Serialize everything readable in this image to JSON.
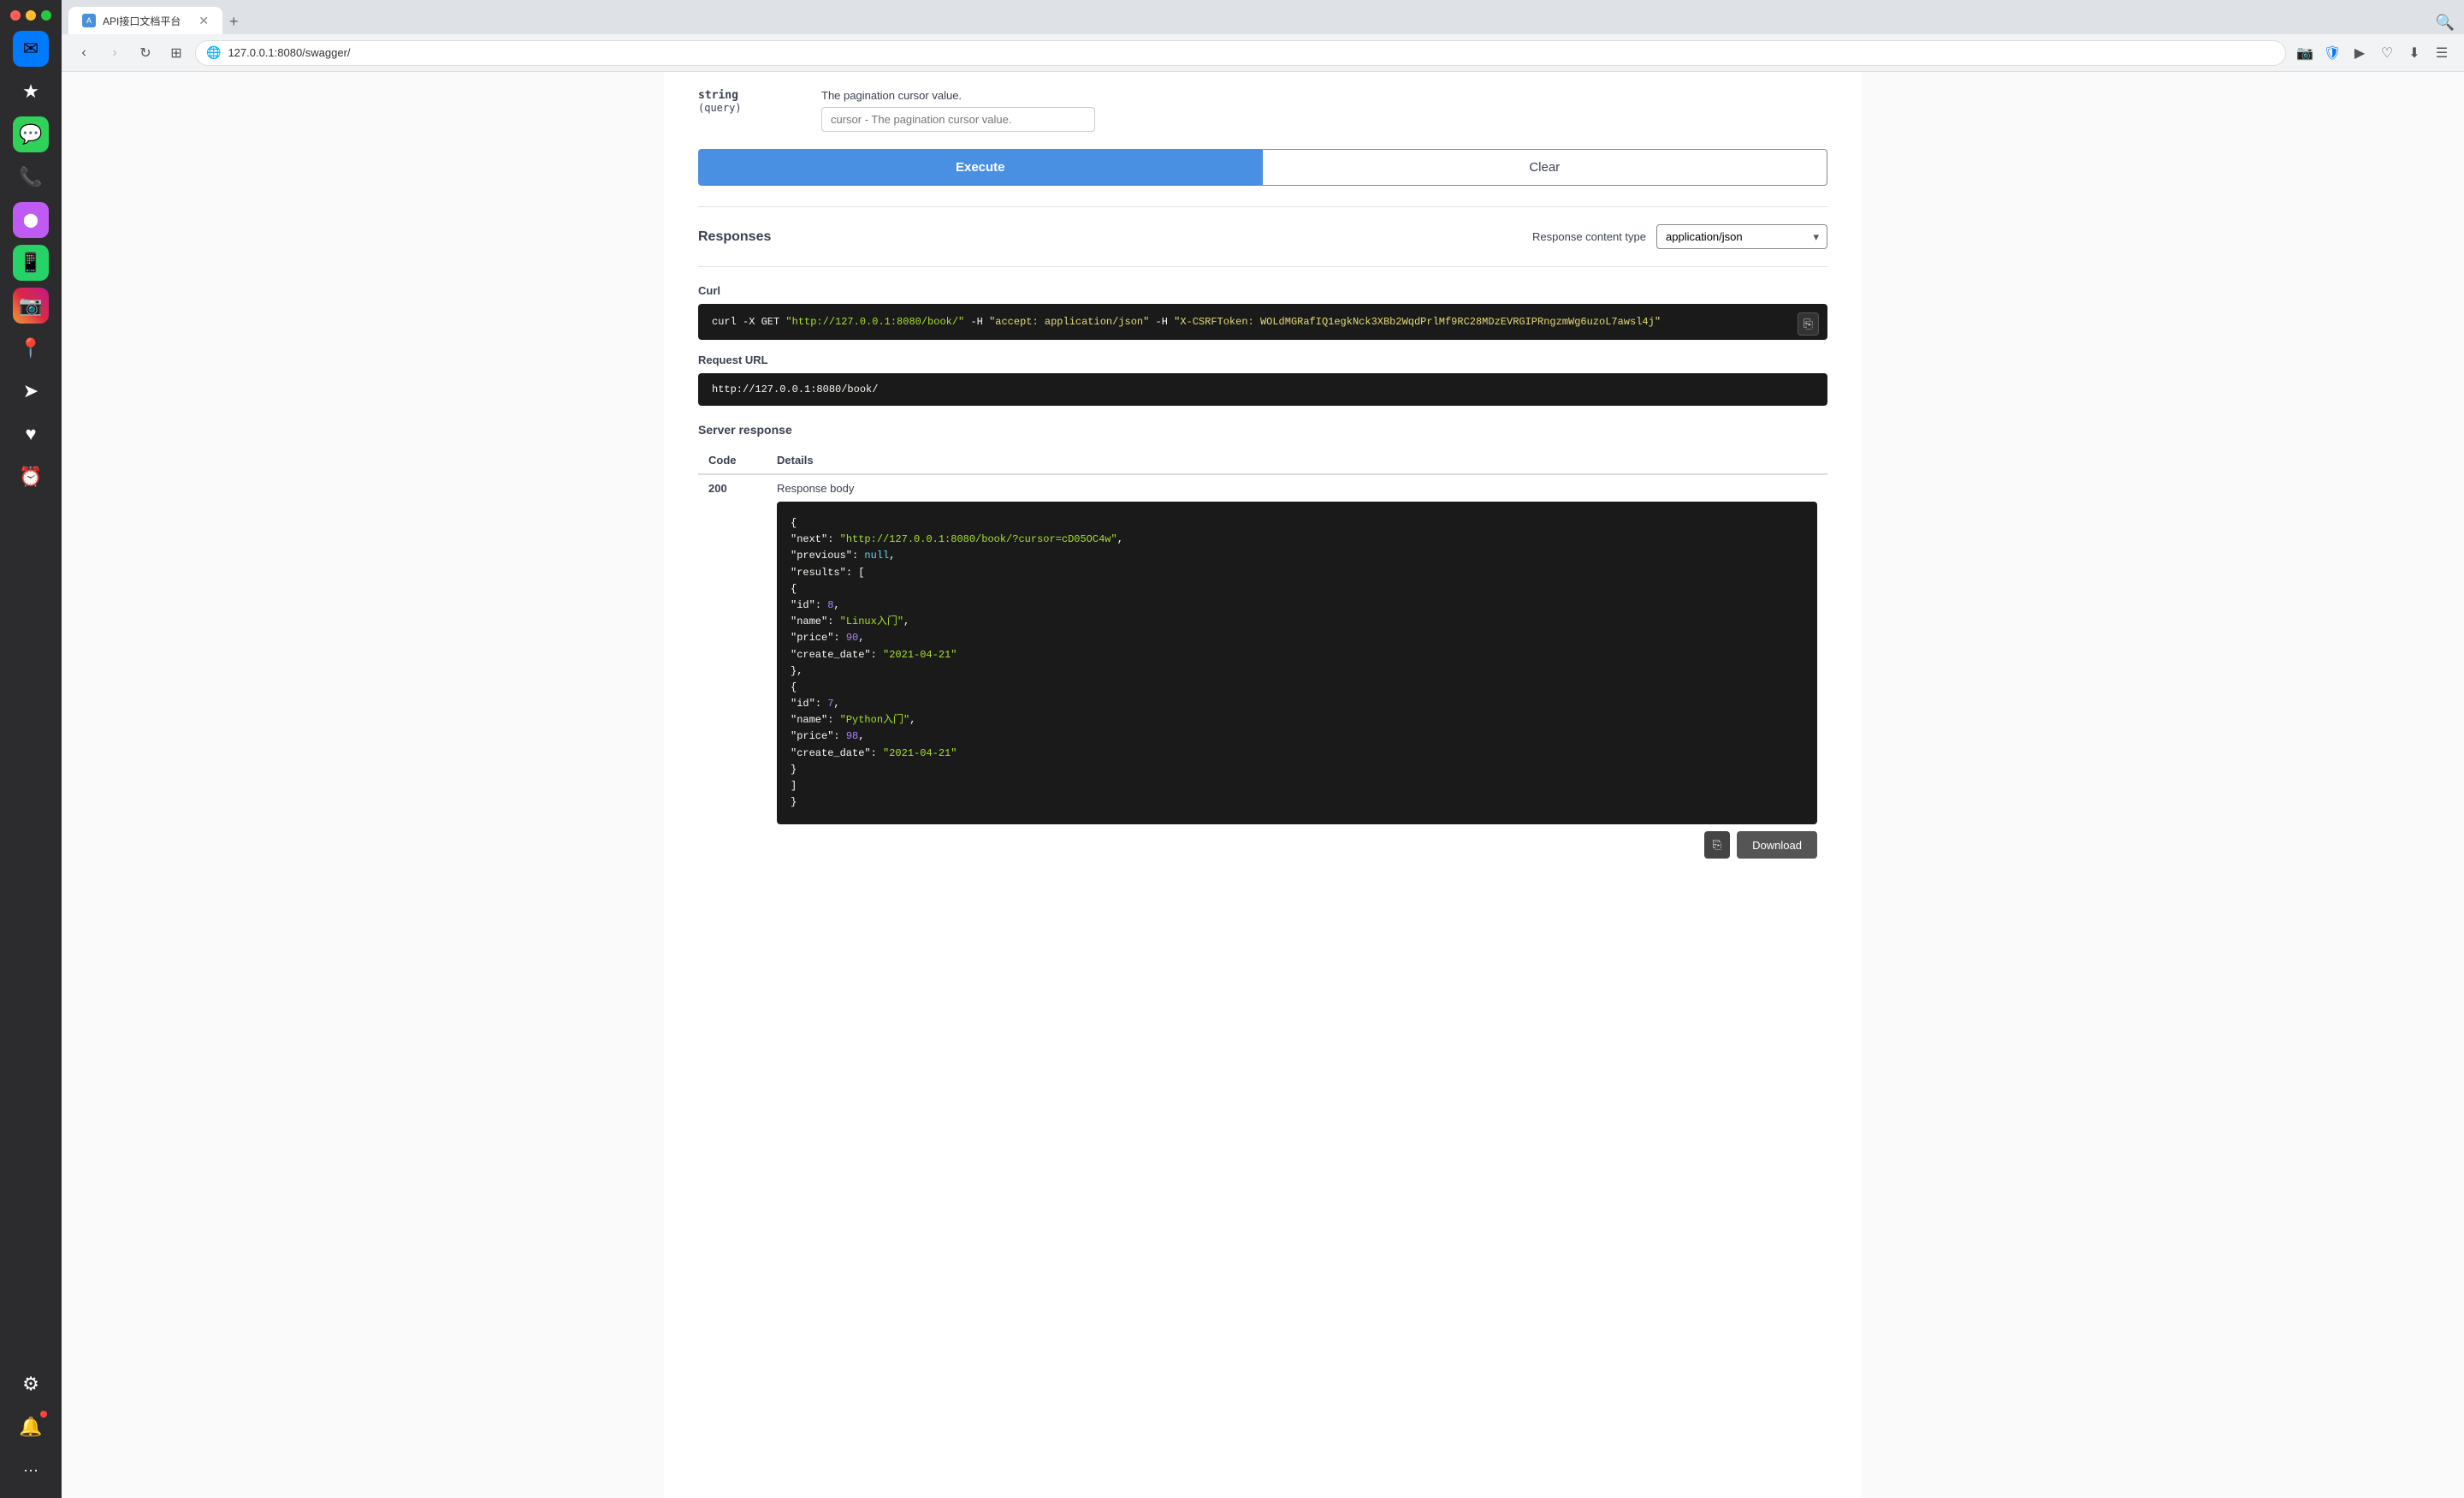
{
  "browser": {
    "tab_label": "API接口文档平台",
    "tab_favicon": "A",
    "address": "127.0.0.1:8080/swagger/"
  },
  "page": {
    "param_type": "string",
    "param_location": "(query)",
    "param_description": "The pagination cursor value.",
    "param_placeholder": "cursor - The pagination cursor value.",
    "execute_label": "Execute",
    "clear_label": "Clear",
    "responses_title": "Responses",
    "response_content_type_label": "Response content type",
    "response_content_type_value": "application/json",
    "curl_section_label": "Curl",
    "curl_command": "curl -X GET",
    "curl_url": "\"http://127.0.0.1:8080/book/\"",
    "curl_headers": "-H  \"accept: application/json\"  -H  \"X-CSRFToken: WOLdMGRafIQ1egkNck3XBb2WqdPrlMf9RC28MDzEVRGIPRngzmWg6uzoL7awsl4j\"",
    "request_url_label": "Request URL",
    "request_url_value": "http://127.0.0.1:8080/book/",
    "server_response_label": "Server response",
    "code_header": "Code",
    "details_header": "Details",
    "response_code": "200",
    "response_body_label": "Response body",
    "response_body": {
      "next_key": "\"next\"",
      "next_value": "\"http://127.0.0.1:8080/book/?cursor=cD05OC4w\"",
      "previous_key": "\"previous\"",
      "previous_value": "null",
      "results_key": "\"results\"",
      "item1_id_key": "\"id\"",
      "item1_id_value": "8",
      "item1_name_key": "\"name\"",
      "item1_name_value": "\"Linux入门\"",
      "item1_price_key": "\"price\"",
      "item1_price_value": "90",
      "item1_date_key": "\"create_date\"",
      "item1_date_value": "\"2021-04-21\"",
      "item2_id_key": "\"id\"",
      "item2_id_value": "7",
      "item2_name_key": "\"name\"",
      "item2_name_value": "\"Python入门\"",
      "item2_price_key": "\"price\"",
      "item2_price_value": "98",
      "item2_date_key": "\"create_date\"",
      "item2_date_value": "\"2021-04-21\""
    },
    "download_label": "Download"
  },
  "sidebar_icons": [
    {
      "name": "mail-icon",
      "symbol": "✉",
      "color": "#007aff"
    },
    {
      "name": "star-icon",
      "symbol": "★",
      "color": "#2c2c2e"
    },
    {
      "name": "chat-icon",
      "symbol": "💬",
      "color": "#30d158"
    },
    {
      "name": "phone-icon",
      "symbol": "📞",
      "color": "#2c2c2e"
    },
    {
      "name": "messenger-icon",
      "symbol": "🟣",
      "color": "#bf5af2"
    },
    {
      "name": "whatsapp-icon",
      "symbol": "📱",
      "color": "#30d158"
    },
    {
      "name": "instagram-icon",
      "symbol": "📸",
      "color": "#ff375f"
    },
    {
      "name": "location-icon",
      "symbol": "📍",
      "color": "#2c2c2e"
    },
    {
      "name": "arrow-icon",
      "symbol": "➤",
      "color": "#2c2c2e"
    },
    {
      "name": "heart-icon",
      "symbol": "♥",
      "color": "#2c2c2e"
    },
    {
      "name": "clock-icon",
      "symbol": "⏰",
      "color": "#2c2c2e"
    },
    {
      "name": "settings-icon",
      "symbol": "⚙",
      "color": "#2c2c2e"
    },
    {
      "name": "notification-icon",
      "symbol": "🔔",
      "color": "#ff453a"
    }
  ]
}
